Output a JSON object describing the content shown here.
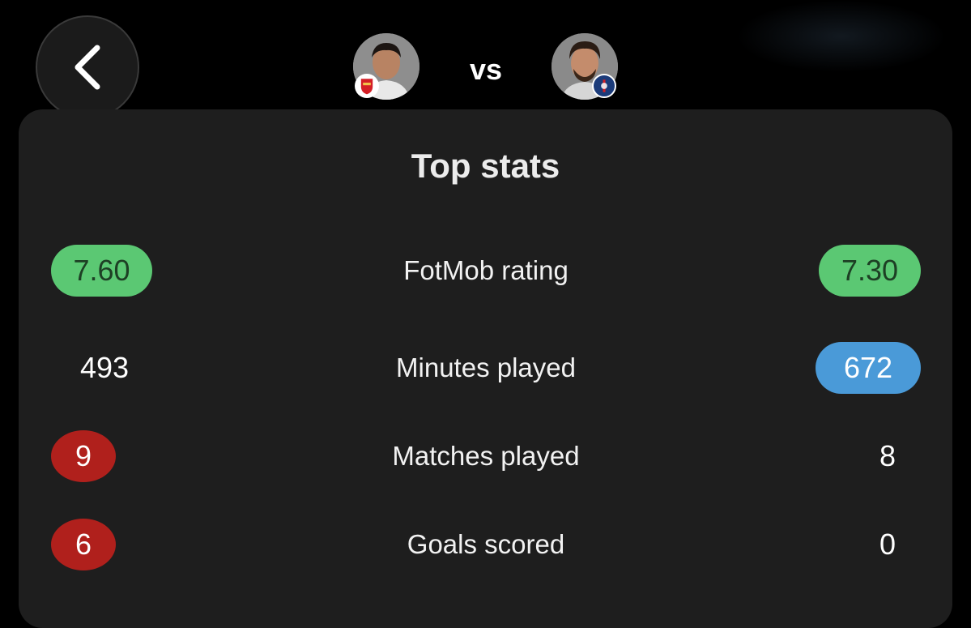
{
  "header": {
    "vs_label": "vs",
    "left_player": {
      "avatar": "player-photo",
      "club_badge": "arsenal-badge"
    },
    "right_player": {
      "avatar": "player-photo",
      "club_badge": "psg-badge"
    },
    "back_icon": "chevron-left-icon"
  },
  "colors": {
    "background": "#000000",
    "card": "#1e1e1e",
    "highlight_green": "#5bc873",
    "highlight_blue": "#4a9ad8",
    "highlight_red": "#b0201c"
  },
  "top_stats": {
    "title": "Top stats",
    "rows": [
      {
        "label": "FotMob rating",
        "left": "7.60",
        "right": "7.30",
        "left_highlight": "green",
        "right_highlight": "green"
      },
      {
        "label": "Minutes played",
        "left": "493",
        "right": "672",
        "left_highlight": "none",
        "right_highlight": "blue"
      },
      {
        "label": "Matches played",
        "left": "9",
        "right": "8",
        "left_highlight": "red",
        "right_highlight": "none"
      },
      {
        "label": "Goals scored",
        "left": "6",
        "right": "0",
        "left_highlight": "red",
        "right_highlight": "none"
      }
    ]
  }
}
